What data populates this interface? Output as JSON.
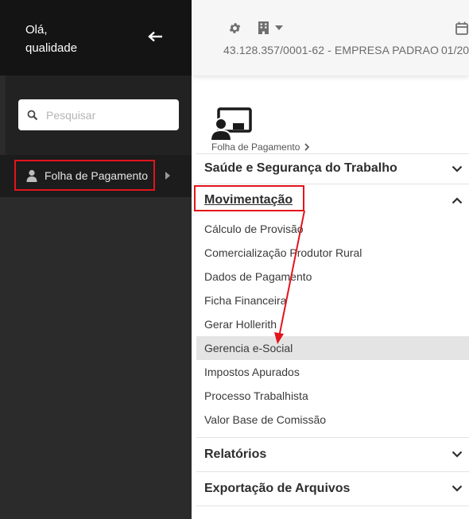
{
  "sidebar": {
    "greeting_line1": "Olá,",
    "greeting_line2": "qualidade",
    "search_placeholder": "Pesquisar",
    "item_label": "Folha de Pagamento"
  },
  "header": {
    "company": "43.128.357/0001-62 - EMPRESA PADRAO",
    "date_partial": "01/20"
  },
  "breadcrumb": {
    "label": "Folha de Pagamento"
  },
  "menu": {
    "sections": {
      "saude": "Saúde e Segurança do Trabalho",
      "movimentacao": "Movimentação",
      "relatorios": "Relatórios",
      "exportacao": "Exportação de Arquivos"
    },
    "sub_items": [
      "Cálculo de Provisão",
      "Comercialização Produtor Rural",
      "Dados de Pagamento",
      "Ficha Financeira",
      "Gerar Hollerith",
      "Gerencia e-Social",
      "Impostos Apurados",
      "Processo Trabalhista",
      "Valor Base de Comissão"
    ],
    "active_sub_item": "Gerencia e-Social"
  },
  "colors": {
    "highlight": "#e3141b",
    "sidebar_dark": "#141414",
    "sidebar_bg": "#2b2b2b"
  }
}
